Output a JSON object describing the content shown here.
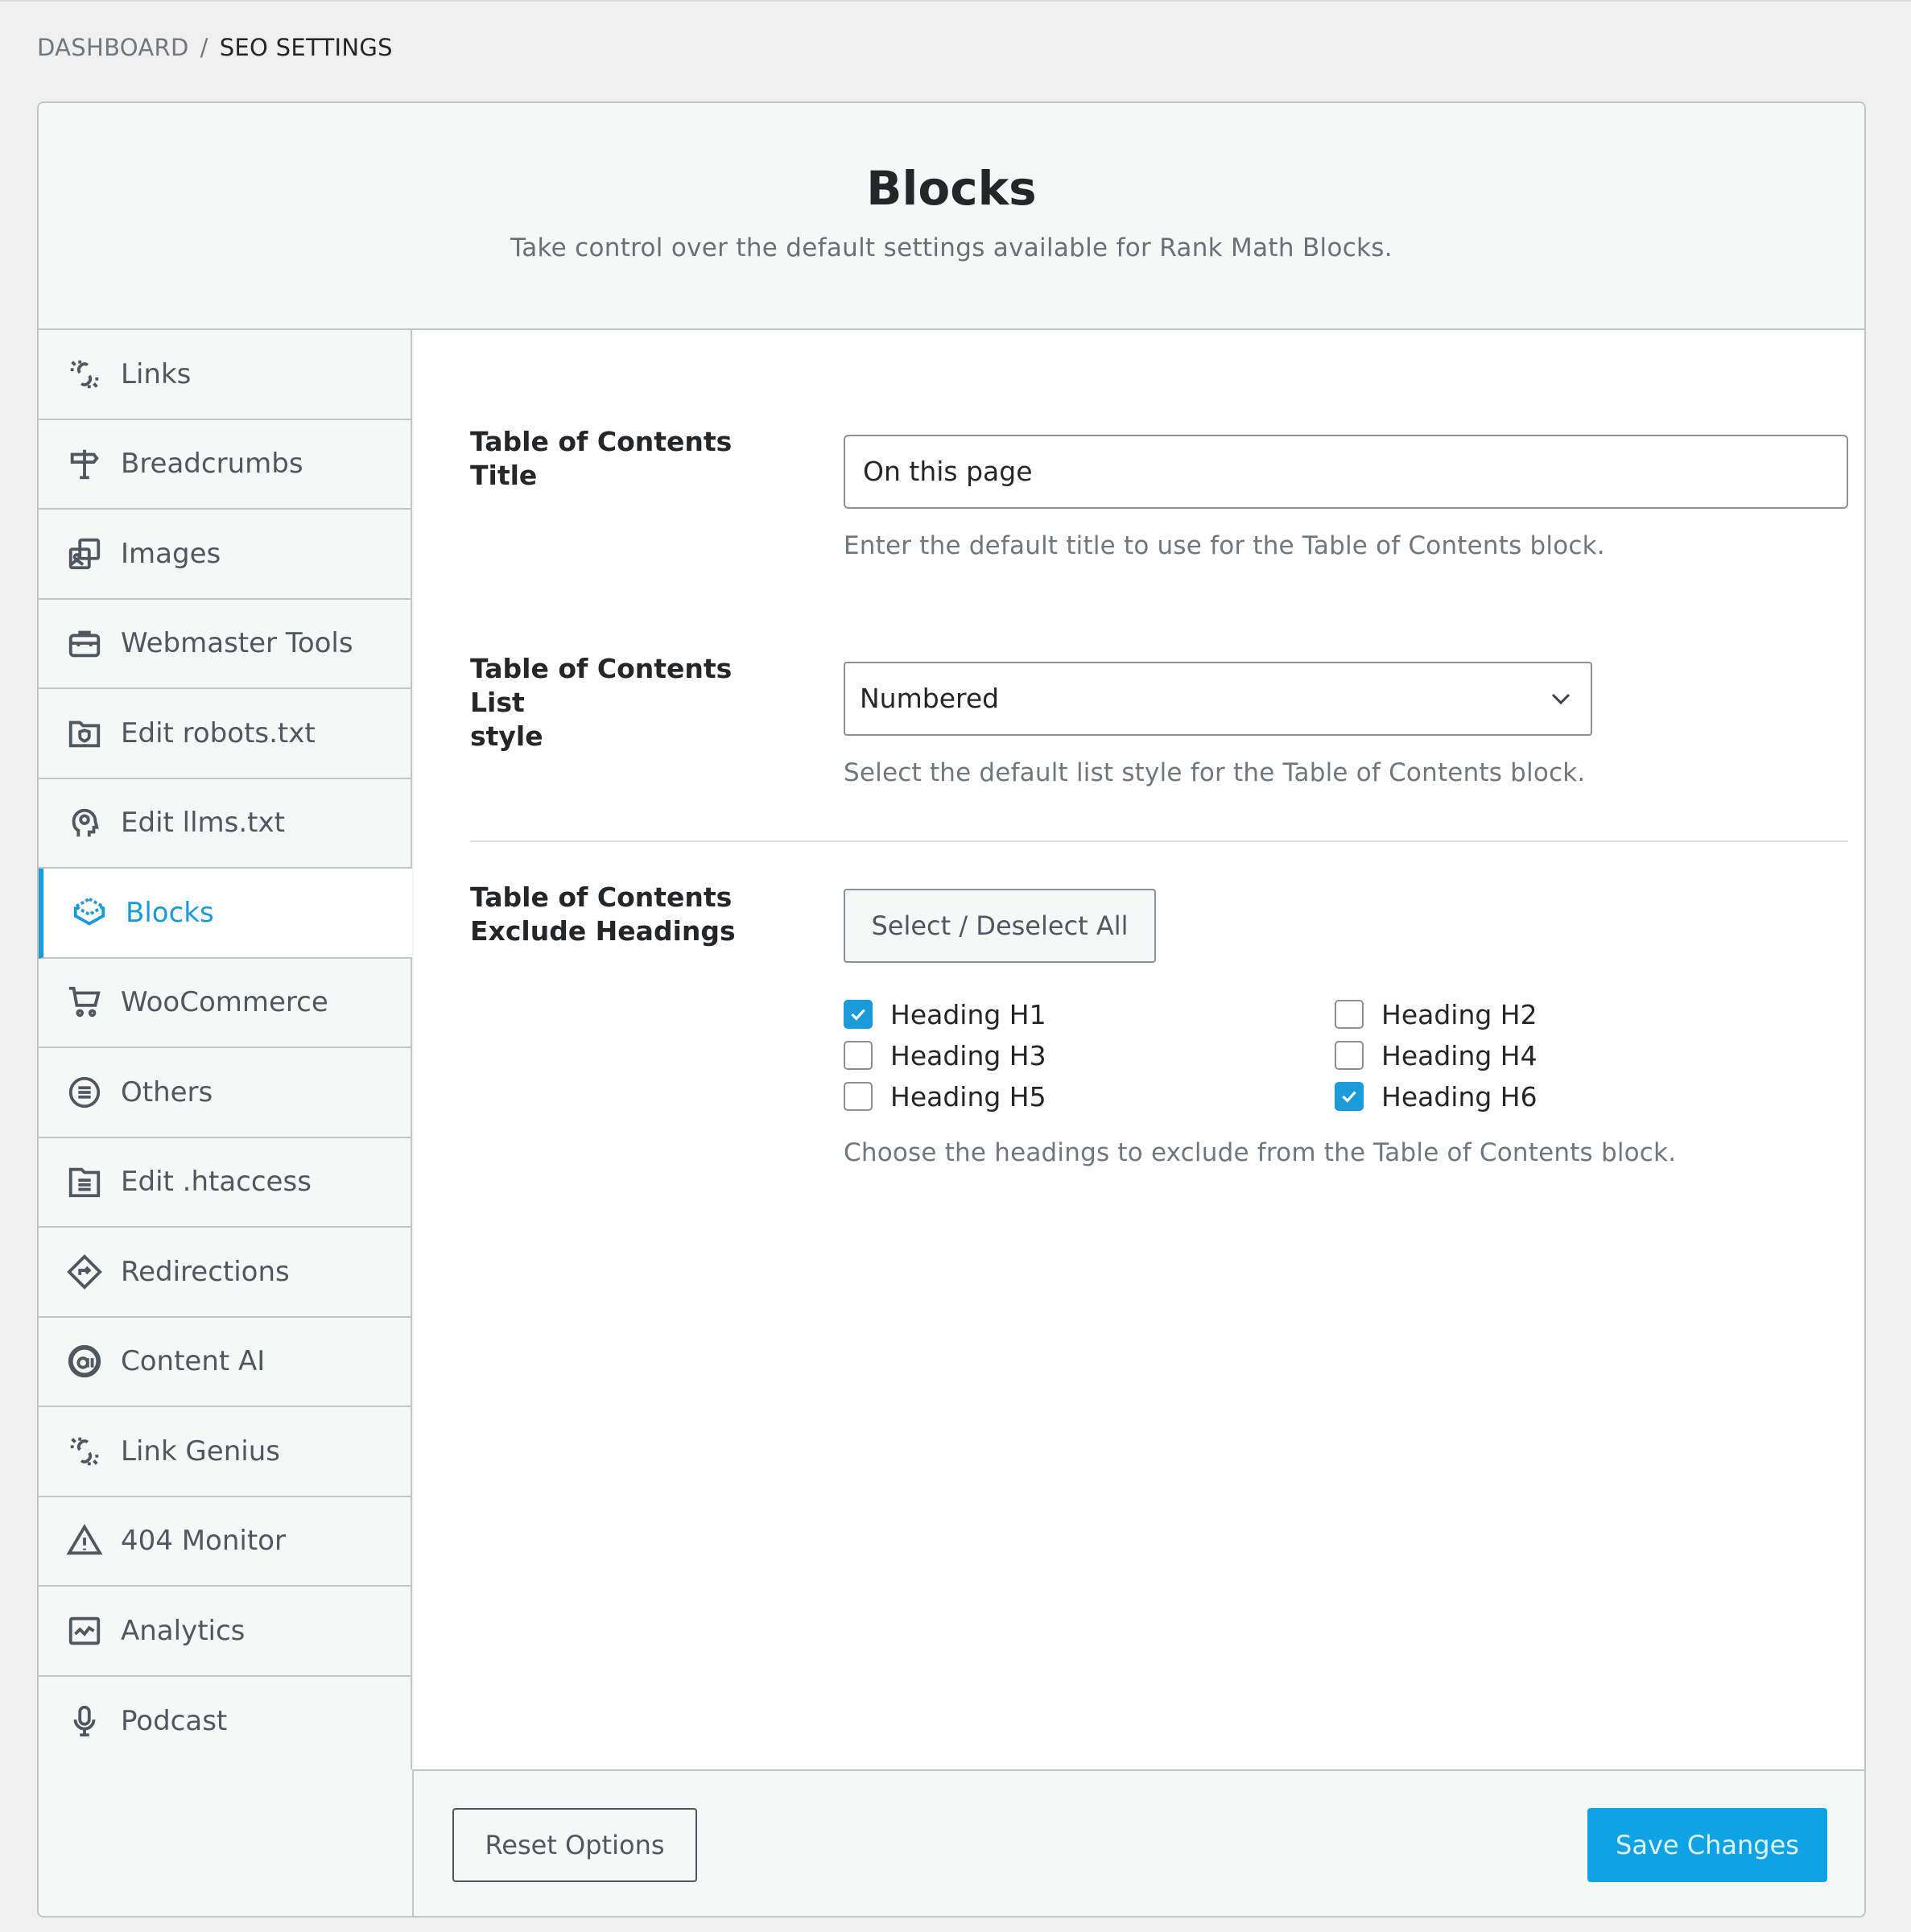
{
  "breadcrumb": {
    "root": "DASHBOARD",
    "separator": "/",
    "current": "SEO SETTINGS"
  },
  "header": {
    "title": "Blocks",
    "subtitle": "Take control over the default settings available for Rank Math Blocks."
  },
  "sidebar": {
    "items": [
      {
        "label": "Links",
        "icon": "link-broken-icon"
      },
      {
        "label": "Breadcrumbs",
        "icon": "signpost-icon"
      },
      {
        "label": "Images",
        "icon": "images-icon"
      },
      {
        "label": "Webmaster Tools",
        "icon": "toolbox-icon"
      },
      {
        "label": "Edit robots.txt",
        "icon": "folder-shield-icon"
      },
      {
        "label": "Edit llms.txt",
        "icon": "head-gear-icon"
      },
      {
        "label": "Blocks",
        "icon": "blocks-icon",
        "active": true
      },
      {
        "label": "WooCommerce",
        "icon": "cart-icon"
      },
      {
        "label": "Others",
        "icon": "list-circle-icon"
      },
      {
        "label": "Edit .htaccess",
        "icon": "file-lines-icon"
      },
      {
        "label": "Redirections",
        "icon": "redirect-diamond-icon"
      },
      {
        "label": "Content AI",
        "icon": "content-ai-icon"
      },
      {
        "label": "Link Genius",
        "icon": "link-broken-icon"
      },
      {
        "label": "404 Monitor",
        "icon": "warning-icon"
      },
      {
        "label": "Analytics",
        "icon": "chart-icon"
      },
      {
        "label": "Podcast",
        "icon": "microphone-icon"
      }
    ]
  },
  "toc_title": {
    "label": "Table of Contents Title",
    "value": "On this page",
    "help": "Enter the default title to use for the Table of Contents block."
  },
  "toc_list_style": {
    "label_line1": "Table of Contents List",
    "label_line2": "style",
    "value": "Numbered",
    "help": "Select the default list style for the Table of Contents block."
  },
  "toc_exclude": {
    "label_line1": "Table of Contents",
    "label_line2": "Exclude Headings",
    "select_all": "Select / Deselect All",
    "headings": [
      {
        "label": "Heading H1",
        "checked": true
      },
      {
        "label": "Heading H2",
        "checked": false
      },
      {
        "label": "Heading H3",
        "checked": false
      },
      {
        "label": "Heading H4",
        "checked": false
      },
      {
        "label": "Heading H5",
        "checked": false
      },
      {
        "label": "Heading H6",
        "checked": true
      }
    ],
    "help": "Choose the headings to exclude from the Table of Contents block."
  },
  "footer": {
    "reset": "Reset Options",
    "save": "Save Changes"
  },
  "colors": {
    "accent": "#1a9bd7",
    "save_button": "#10a3e3"
  }
}
